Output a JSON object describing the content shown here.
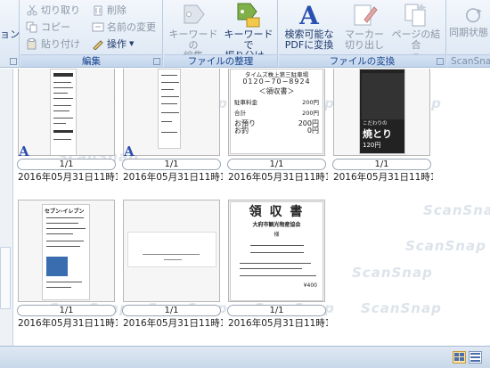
{
  "ribbon": {
    "cut_left": "ョン",
    "cut": "切り取り",
    "copy": "コピー",
    "paste": "貼り付け",
    "delete": "削除",
    "rename": "名前の変更",
    "operation": "操作",
    "edit_group": "編集",
    "keyword_edit": [
      "キーワードの",
      "編集"
    ],
    "keyword_sort": [
      "キーワードで",
      "振り分け"
    ],
    "file_org_group": "ファイルの整理",
    "searchable_pdf": [
      "検索可能な",
      "PDFに変換"
    ],
    "marker": [
      "マーカー",
      "切り出し"
    ],
    "page_join": [
      "ページの結合"
    ],
    "file_conv_group": "ファイルの変換",
    "sync_status": "同期状態",
    "scansnap_group": "ScanSnap"
  },
  "watermark": "ScanSnap",
  "thumbnails": [
    {
      "pages": "1/1",
      "date": "2016年05月31日11時10:",
      "ocr": "A",
      "receipt_kind": "narrow-long"
    },
    {
      "pages": "1/1",
      "date": "2016年05月31日11時10:",
      "ocr": "A",
      "receipt_kind": "narrow"
    },
    {
      "pages": "1/1",
      "date": "2016年05月31日11時10:",
      "ocr": "",
      "receipt_kind": "parking",
      "text": {
        "l1": "タイムズ株上第三駐車場",
        "l2": "0120−70−8924",
        "title": "＜領収書＞",
        "l3": "駐車料金",
        "l4": "200円",
        "l5": "合計",
        "l6": "200円",
        "l7": "お預り",
        "l8": "200円",
        "l9": "お釣",
        "l10": "0円"
      }
    },
    {
      "pages": "1/1",
      "date": "2016年05月31日11時1:",
      "ocr": "",
      "receipt_kind": "yakitori",
      "text": {
        "a": "こだわりの",
        "b": "焼とり",
        "c": "120円"
      }
    },
    {
      "pages": "1/1",
      "date": "2016年05月31日11時11:",
      "ocr": "",
      "receipt_kind": "seven",
      "text": {
        "a": "セブン-イレブン"
      }
    },
    {
      "pages": "1/1",
      "date": "2016年05月31日11時11:",
      "ocr": "",
      "receipt_kind": "ticket"
    },
    {
      "pages": "1/1",
      "date": "2016年05月31日11時12:",
      "ocr": "",
      "receipt_kind": "ryoshu",
      "text": {
        "title": "領 収 書",
        "shop": "大府市観光物産協会",
        "to": "様",
        "amt": "¥400"
      }
    },
    {
      "pages": "1/1",
      "date": "2016年05月31日11時1:",
      "ocr": "",
      "receipt_kind": "empty"
    }
  ],
  "colors": {
    "ribbon_text": "#15428b",
    "ocr_badge": "#2b4fb0"
  }
}
